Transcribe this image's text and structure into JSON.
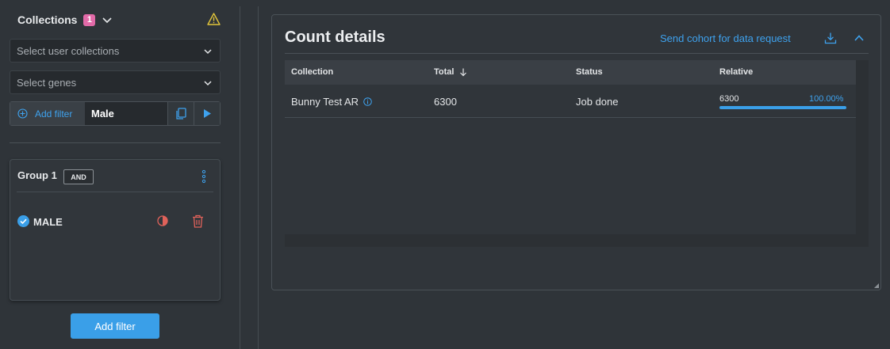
{
  "sidebar": {
    "collections_title": "Collections",
    "collections_count": "1",
    "user_collections_placeholder": "Select user collections",
    "genes_placeholder": "Select genes",
    "add_filter_inline_label": "Add filter",
    "filter_value": "Male",
    "group": {
      "title": "Group 1",
      "operator": "AND",
      "condition": "MALE"
    },
    "add_filter_button": "Add filter"
  },
  "count_details": {
    "title": "Count details",
    "send_link": "Send cohort for data request",
    "columns": [
      "Collection",
      "Total",
      "Status",
      "Relative"
    ],
    "rows": [
      {
        "collection": "Bunny Test AR",
        "total": "6300",
        "status": "Job done",
        "relative_value": "6300",
        "relative_percent": "100.00%",
        "relative_fraction": 1.0
      }
    ]
  },
  "colors": {
    "accent": "#3a9fe8",
    "badge": "#e26aa8",
    "warning": "#e2c53a",
    "danger": "#e0625a"
  }
}
